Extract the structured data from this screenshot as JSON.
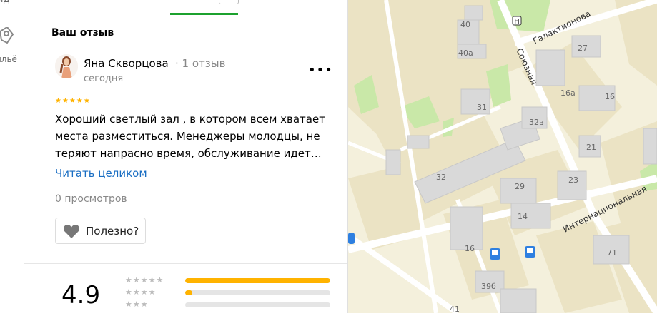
{
  "rail": {
    "top_text": "ид",
    "label": "ильë"
  },
  "review": {
    "heading": "Ваш отзыв",
    "author": "Яна Скворцова",
    "author_review_count": "· 1 отзыв",
    "date": "сегодня",
    "more_label": "•••",
    "stars": "★★★★★",
    "rating_value": 5,
    "text": "Хороший светлый зал , в котором всем хватает места разместиться. Менеджеры молодцы, не теряют напрасно время, обслуживание идет…",
    "read_more": "Читать целиком",
    "views": "0 просмотров",
    "helpful_label": "Полезно?"
  },
  "summary": {
    "rating": "4.9",
    "rows": [
      {
        "stars": "★★★★★",
        "fraction": 1.0
      },
      {
        "stars": "★★★★",
        "fraction": 0.05
      },
      {
        "stars": "★★★",
        "fraction": 0.0
      }
    ]
  },
  "map": {
    "streets": [
      "Галактионова",
      "Союзная",
      "Интернациональная"
    ],
    "buildings": [
      "40",
      "40а",
      "27",
      "16а",
      "16",
      "31",
      "32в",
      "21",
      "32",
      "29",
      "23",
      "14",
      "16",
      "71",
      "39б",
      "41"
    ],
    "colors": {
      "background": "#f4f0dc",
      "block": "#ebe3c4",
      "building": "#d9d9d9",
      "park": "#c9e8a8",
      "road": "#ffffff",
      "bus": "#2e7fe0"
    }
  }
}
